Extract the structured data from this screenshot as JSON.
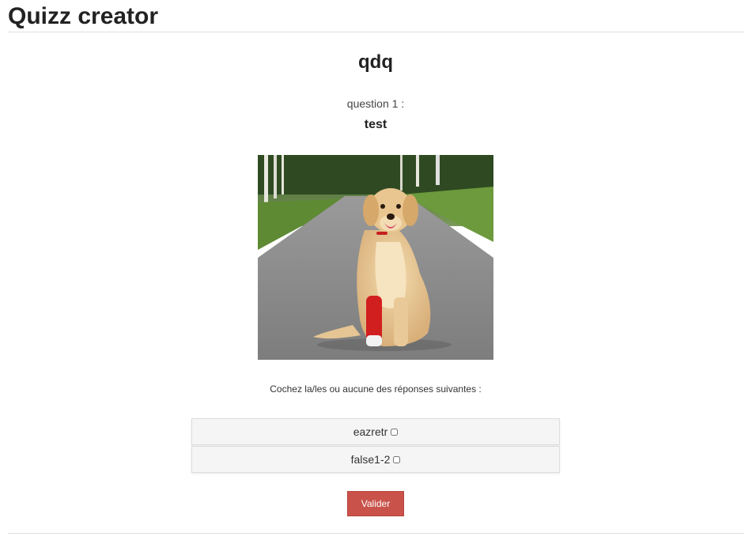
{
  "app": {
    "title": "Quizz creator"
  },
  "quiz": {
    "title": "qdq",
    "question_number": "question 1 :",
    "question_text": "test",
    "image": {
      "icon": "photo-dog-with-bandaged-leg"
    },
    "instructions": "Cochez la/les ou aucune des réponses suivantes :",
    "answers": [
      {
        "label": "eazretr",
        "checked": false
      },
      {
        "label": "false1-2",
        "checked": false
      }
    ],
    "submit_label": "Valider"
  },
  "colors": {
    "submit_button": "#c9524a",
    "answer_background": "#f5f5f5",
    "rule": "#dddddd"
  }
}
